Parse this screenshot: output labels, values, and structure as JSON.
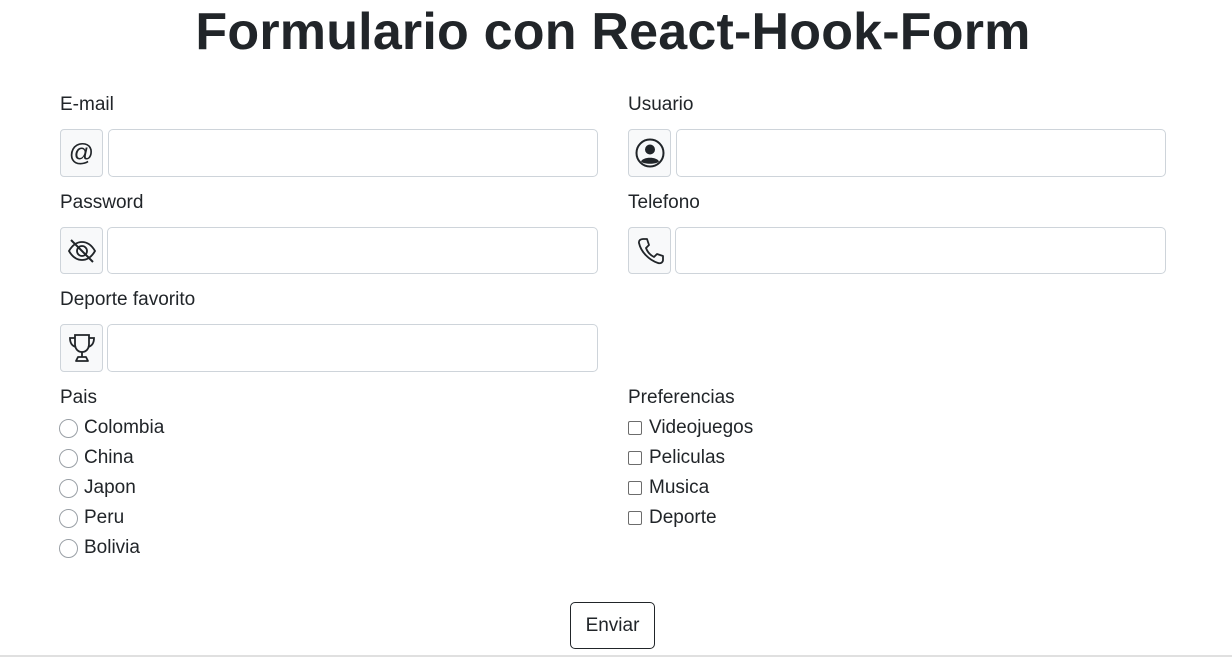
{
  "title": "Formulario con React-Hook-Form",
  "fields": {
    "email": {
      "label": "E-mail",
      "value": "",
      "icon": "at-sign-icon",
      "glyph": "@"
    },
    "usuario": {
      "label": "Usuario",
      "value": "",
      "icon": "user-circle-icon"
    },
    "password": {
      "label": "Password",
      "value": "",
      "icon": "eye-slash-icon"
    },
    "telefono": {
      "label": "Telefono",
      "value": "",
      "icon": "phone-icon"
    },
    "deporte": {
      "label": "Deporte favorito",
      "value": "",
      "icon": "trophy-icon"
    }
  },
  "pais": {
    "label": "Pais",
    "options": [
      "Colombia",
      "China",
      "Japon",
      "Peru",
      "Bolivia"
    ],
    "selected": null
  },
  "preferencias": {
    "label": "Preferencias",
    "options": [
      "Videojuegos",
      "Peliculas",
      "Musica",
      "Deporte"
    ],
    "checked": []
  },
  "submit_label": "Enviar"
}
